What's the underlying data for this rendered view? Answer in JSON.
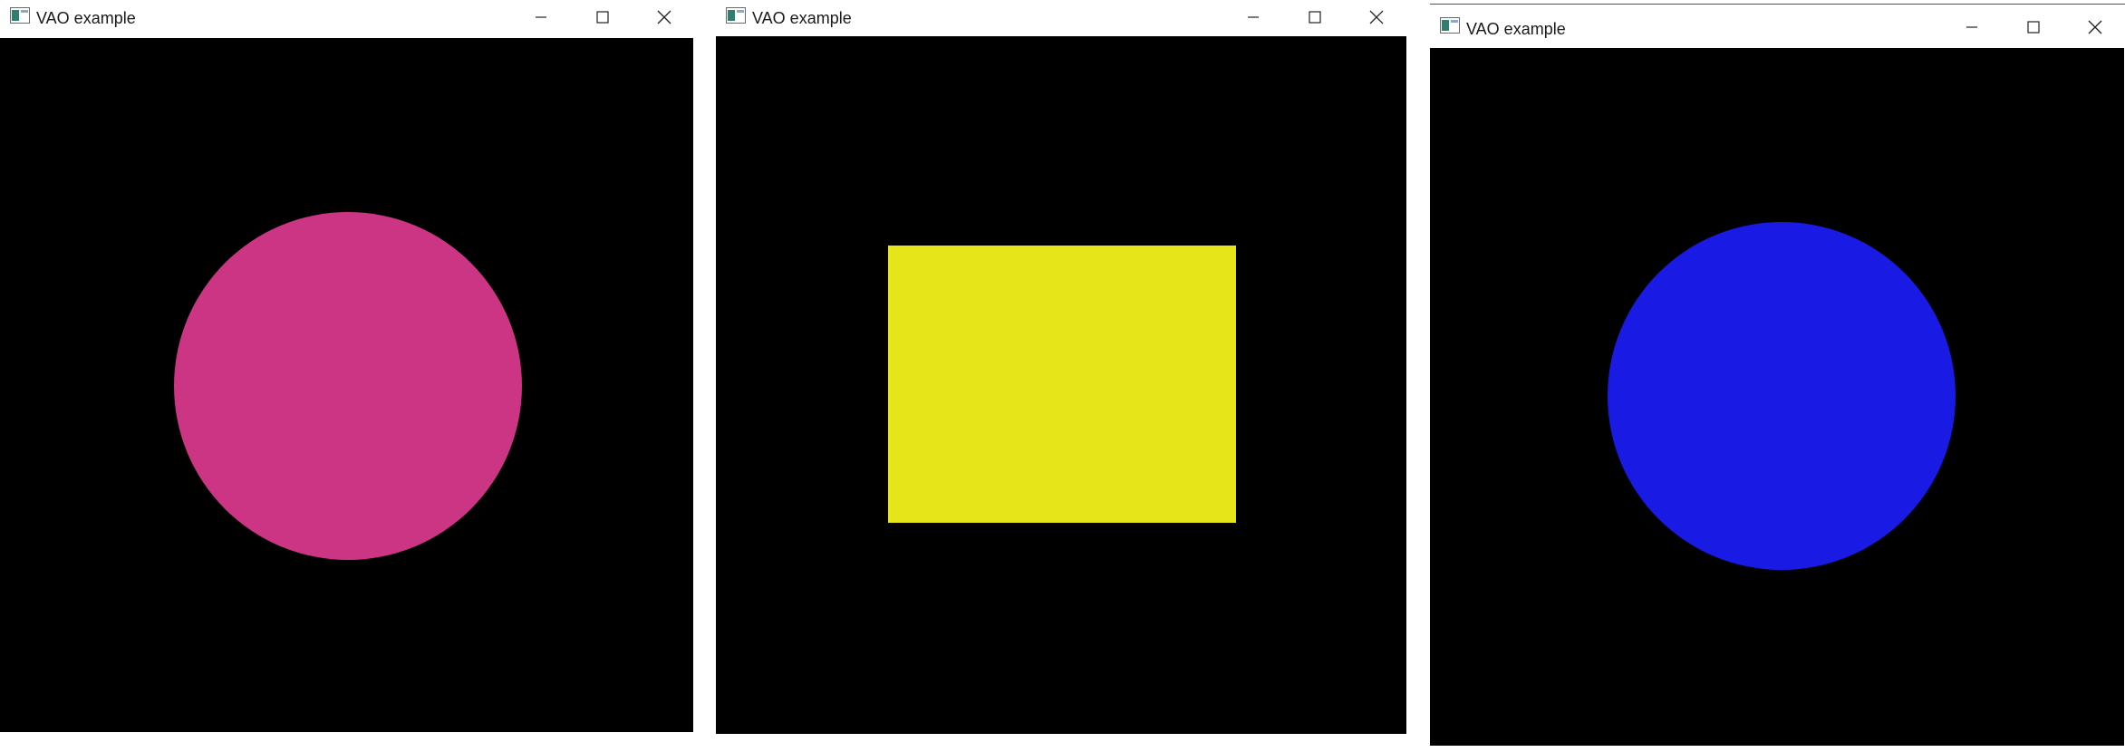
{
  "windows": [
    {
      "title": "VAO example",
      "shape": {
        "type": "circle",
        "color": "#cc3583"
      }
    },
    {
      "title": "VAO example",
      "shape": {
        "type": "rectangle",
        "color": "#e5e51a"
      }
    },
    {
      "title": "VAO example",
      "shape": {
        "type": "circle",
        "color": "#1a1ae5"
      }
    }
  ],
  "icons": {
    "app": "application-icon",
    "minimize": "minimize-icon",
    "maximize": "maximize-icon",
    "close": "close-icon"
  }
}
